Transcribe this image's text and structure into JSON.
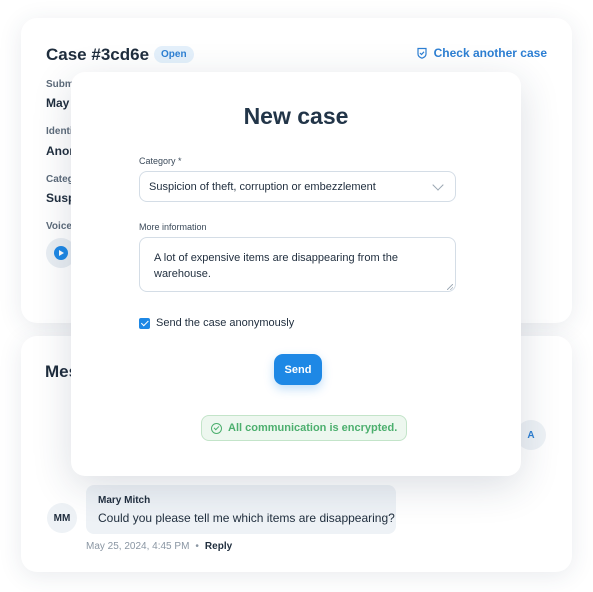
{
  "case": {
    "title": "Case #3cd6e",
    "status": "Open",
    "check_link": "Check another case",
    "fields": [
      {
        "label": "Submi",
        "value": "May"
      },
      {
        "label": "Identi",
        "value": "Anor"
      },
      {
        "label": "Categ",
        "value": "Susp"
      },
      {
        "label": "Voice",
        "value": ""
      }
    ]
  },
  "messages": {
    "title": "Mes",
    "reply_avatar": "A",
    "items": [
      {
        "avatar": "MM",
        "author": "Mary Mitch",
        "text": "Could you please tell me which items are disappearing?",
        "timestamp": "May 25, 2024, 4:45 PM",
        "separator": "•",
        "reply_label": "Reply"
      }
    ]
  },
  "modal": {
    "title": "New case",
    "category_label": "Category *",
    "category_value": "Suspicion of theft, corruption or embezzlement",
    "info_label": "More information",
    "info_value": "A lot of expensive items are disappearing from the warehouse.",
    "anonymous_label": "Send the case anonymously",
    "anonymous_checked": true,
    "send_label": "Send",
    "encrypted_note": "All communication is encrypted."
  },
  "colors": {
    "accent": "#1e88e5",
    "success": "#4caf6e",
    "text": "#1f2d3d"
  }
}
